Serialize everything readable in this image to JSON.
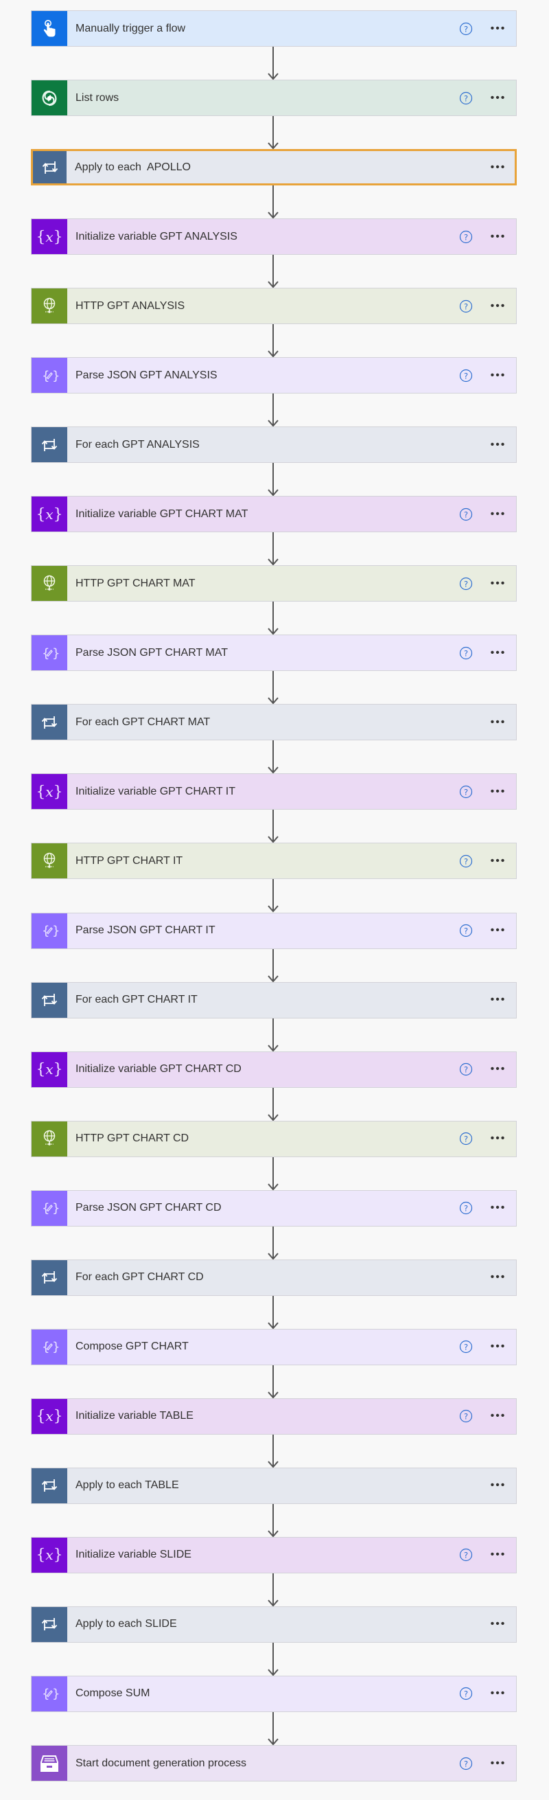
{
  "flow": {
    "steps": [
      {
        "label": "Manually trigger a flow",
        "type": "trigger",
        "icon": "touch-hand-icon",
        "has_help": true,
        "selected": false,
        "color": "#1170e4"
      },
      {
        "label": "List rows",
        "type": "dataverse",
        "icon": "dataverse-icon",
        "has_help": true,
        "selected": false,
        "color": "#0d7b40"
      },
      {
        "label": "Apply to each  APOLLO",
        "type": "loop",
        "icon": "loop-icon",
        "has_help": false,
        "selected": true,
        "color": "#486991"
      },
      {
        "label": "Initialize variable GPT ANALYSIS",
        "type": "variable",
        "icon": "variable-icon",
        "has_help": true,
        "selected": false,
        "color": "#770bd6"
      },
      {
        "label": "HTTP GPT ANALYSIS",
        "type": "http",
        "icon": "globe-icon",
        "has_help": true,
        "selected": false,
        "color": "#709727"
      },
      {
        "label": "Parse JSON GPT ANALYSIS",
        "type": "json",
        "icon": "data-operation-icon",
        "has_help": true,
        "selected": false,
        "color": "#8c6cff"
      },
      {
        "label": "For each GPT ANALYSIS",
        "type": "loop",
        "icon": "loop-icon",
        "has_help": false,
        "selected": false,
        "color": "#486991"
      },
      {
        "label": "Initialize variable GPT CHART MAT",
        "type": "variable",
        "icon": "variable-icon",
        "has_help": true,
        "selected": false,
        "color": "#770bd6"
      },
      {
        "label": "HTTP GPT CHART MAT",
        "type": "http",
        "icon": "globe-icon",
        "has_help": true,
        "selected": false,
        "color": "#709727"
      },
      {
        "label": "Parse JSON GPT CHART MAT",
        "type": "json",
        "icon": "data-operation-icon",
        "has_help": true,
        "selected": false,
        "color": "#8c6cff"
      },
      {
        "label": "For each GPT CHART MAT",
        "type": "loop",
        "icon": "loop-icon",
        "has_help": false,
        "selected": false,
        "color": "#486991"
      },
      {
        "label": "Initialize variable GPT CHART IT",
        "type": "variable",
        "icon": "variable-icon",
        "has_help": true,
        "selected": false,
        "color": "#770bd6"
      },
      {
        "label": "HTTP GPT CHART IT",
        "type": "http",
        "icon": "globe-icon",
        "has_help": true,
        "selected": false,
        "color": "#709727"
      },
      {
        "label": "Parse JSON GPT CHART IT",
        "type": "json",
        "icon": "data-operation-icon",
        "has_help": true,
        "selected": false,
        "color": "#8c6cff"
      },
      {
        "label": "For each GPT CHART IT",
        "type": "loop",
        "icon": "loop-icon",
        "has_help": false,
        "selected": false,
        "color": "#486991"
      },
      {
        "label": "Initialize variable GPT CHART CD",
        "type": "variable",
        "icon": "variable-icon",
        "has_help": true,
        "selected": false,
        "color": "#770bd6"
      },
      {
        "label": "HTTP GPT CHART CD",
        "type": "http",
        "icon": "globe-icon",
        "has_help": true,
        "selected": false,
        "color": "#709727"
      },
      {
        "label": "Parse JSON GPT CHART CD",
        "type": "json",
        "icon": "data-operation-icon",
        "has_help": true,
        "selected": false,
        "color": "#8c6cff"
      },
      {
        "label": "For each GPT CHART CD",
        "type": "loop",
        "icon": "loop-icon",
        "has_help": false,
        "selected": false,
        "color": "#486991"
      },
      {
        "label": "Compose GPT CHART",
        "type": "json",
        "icon": "data-operation-icon",
        "has_help": true,
        "selected": false,
        "color": "#8c6cff"
      },
      {
        "label": "Initialize variable TABLE",
        "type": "variable",
        "icon": "variable-icon",
        "has_help": true,
        "selected": false,
        "color": "#770bd6"
      },
      {
        "label": "Apply to each TABLE",
        "type": "loop",
        "icon": "loop-icon",
        "has_help": false,
        "selected": false,
        "color": "#486991"
      },
      {
        "label": "Initialize variable SLIDE",
        "type": "variable",
        "icon": "variable-icon",
        "has_help": true,
        "selected": false,
        "color": "#770bd6"
      },
      {
        "label": "Apply to each SLIDE",
        "type": "loop",
        "icon": "loop-icon",
        "has_help": false,
        "selected": false,
        "color": "#486991"
      },
      {
        "label": "Compose SUM",
        "type": "json",
        "icon": "data-operation-icon",
        "has_help": true,
        "selected": false,
        "color": "#8c6cff"
      },
      {
        "label": "Start document generation process",
        "type": "docgen",
        "icon": "file-cabinet-icon",
        "has_help": true,
        "selected": false,
        "color": "#8a4fc8"
      }
    ],
    "help_icon": "help-circle-icon",
    "more_icon": "more-options-icon",
    "more_label": "•••",
    "connector_icon": "arrow-down-icon",
    "selected_border_color": "#e8a33a",
    "help_color": "#2f6fd0"
  }
}
